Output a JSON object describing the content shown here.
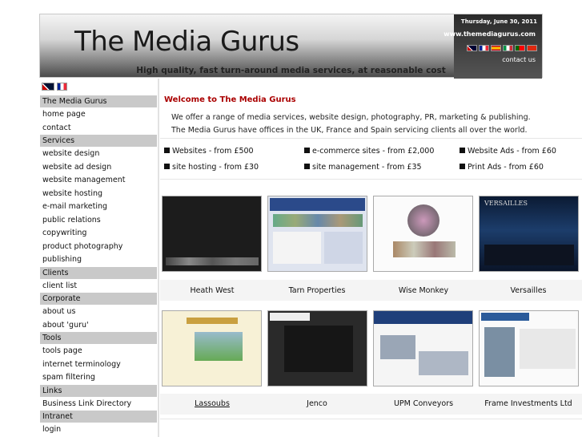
{
  "header": {
    "logo": "The Media Gurus",
    "date": "Thursday, June 30, 2011",
    "url": "www.themediagurus.com",
    "contact": "contact us",
    "tagline": "High quality, fast turn-around media services, at reasonable cost"
  },
  "sidebar": {
    "sections": [
      {
        "title": "The Media Gurus",
        "items": [
          "home page",
          "contact"
        ]
      },
      {
        "title": "Services",
        "items": [
          "website design",
          "website ad design",
          "website management",
          "website hosting",
          "e-mail marketing",
          "public relations",
          "copywriting",
          "product photography",
          "publishing"
        ]
      },
      {
        "title": "Clients",
        "items": [
          "client list"
        ]
      },
      {
        "title": "Corporate",
        "items": [
          "about us",
          "about 'guru'"
        ]
      },
      {
        "title": "Tools",
        "items": [
          "tools page",
          "internet terminology",
          "spam filtering"
        ]
      },
      {
        "title": "Links",
        "items": [
          "Business Link Directory"
        ]
      },
      {
        "title": "Intranet",
        "items": [
          "login"
        ]
      }
    ]
  },
  "main": {
    "welcome": "Welcome to The Media Gurus",
    "intro1": "We offer a range of media services, website design, photography, PR, marketing & publishing.",
    "intro2": "The Media Gurus have offices in the UK, France and Spain servicing clients all over the world.",
    "offers": [
      "Websites - from £500",
      "e-commerce sites - from £2,000",
      "Website Ads - from £60",
      "site hosting - from £30",
      "site management - from £35",
      "Print Ads - from £60"
    ],
    "clients": [
      "Heath West",
      "Tarn Properties",
      "Wise Monkey",
      "Versailles",
      "Lassoubs",
      "Jenco",
      "UPM Conveyors",
      "Frame Investments Ltd"
    ]
  },
  "colors": {
    "accent": "#aa0000",
    "section_bg": "#c9c9c9"
  }
}
